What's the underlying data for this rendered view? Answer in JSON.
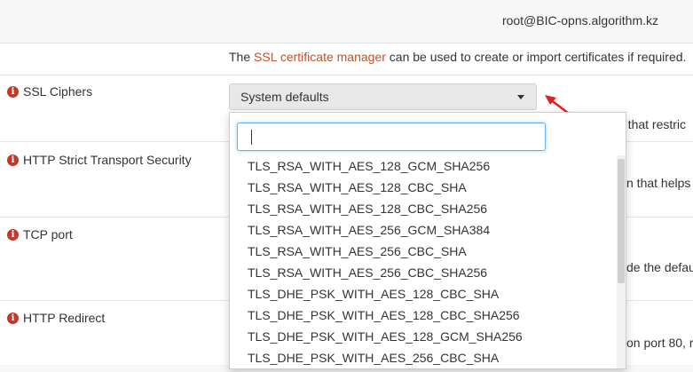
{
  "header": {
    "user": "root@BIC-opns.algorithm.kz"
  },
  "cert_note": {
    "prefix": "The ",
    "link": "SSL certificate manager",
    "suffix": " can be used to create or import certificates if required."
  },
  "fields": {
    "ssl_ciphers": {
      "label": "SSL Ciphers",
      "partial_desc": "e that restric"
    },
    "hsts": {
      "label": "HTTP Strict Transport Security",
      "partial_desc": "n that helps"
    },
    "tcp_port": {
      "label": "TCP port",
      "partial_desc": "de the defau"
    },
    "http_redirect": {
      "label": "HTTP Redirect",
      "partial_desc": "on port 80, r"
    }
  },
  "select": {
    "value": "System defaults"
  },
  "dropdown": {
    "search_value": "",
    "options": [
      "TLS_RSA_WITH_AES_128_GCM_SHA256",
      "TLS_RSA_WITH_AES_128_CBC_SHA",
      "TLS_RSA_WITH_AES_128_CBC_SHA256",
      "TLS_RSA_WITH_AES_256_GCM_SHA384",
      "TLS_RSA_WITH_AES_256_CBC_SHA",
      "TLS_RSA_WITH_AES_256_CBC_SHA256",
      "TLS_DHE_PSK_WITH_AES_128_CBC_SHA",
      "TLS_DHE_PSK_WITH_AES_128_CBC_SHA256",
      "TLS_DHE_PSK_WITH_AES_128_GCM_SHA256",
      "TLS_DHE_PSK_WITH_AES_256_CBC_SHA"
    ]
  },
  "colors": {
    "link": "#c0512c",
    "info_icon": "#c0392b",
    "annotation_arrow": "#e02020"
  }
}
